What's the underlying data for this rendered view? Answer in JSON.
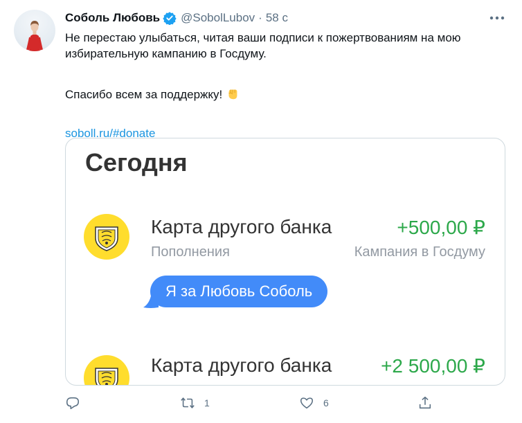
{
  "tweet": {
    "author_name": "Соболь Любовь",
    "handle": "@SobolLubov",
    "separator": "·",
    "time": "58 с",
    "text_line1": "Не перестаю улыбаться, читая ваши подписи к пожертвованиям на мою",
    "text_line2": "избирательную кампанию в Госдуму.",
    "text_thanks": "Спасибо всем за поддержку!",
    "emoji": "raised-fist-emoji",
    "link": "soboll.ru/#donate",
    "icons": {
      "verified": "verified-badge-icon",
      "more": "more-options-icon"
    }
  },
  "card": {
    "title": "Сегодня",
    "transactions": [
      {
        "name": "Карта другого банка",
        "amount": "+500,00 ₽",
        "category": "Пополнения",
        "account": "Кампания в Госдуму"
      },
      {
        "name": "Карта другого банка",
        "amount": "+2 500,00 ₽"
      }
    ],
    "message": "Я за Любовь Соболь"
  },
  "actions": {
    "reply": {
      "icon": "reply-icon"
    },
    "retweet": {
      "icon": "retweet-icon",
      "count": "1"
    },
    "like": {
      "icon": "like-icon",
      "count": "6"
    },
    "share": {
      "icon": "share-icon"
    }
  },
  "colors": {
    "accent": "#1b95e0",
    "muted": "#5b7083",
    "amount_green": "#2ca84a",
    "bank_yellow": "#ffdd2d",
    "bubble_blue": "#428bf9"
  }
}
